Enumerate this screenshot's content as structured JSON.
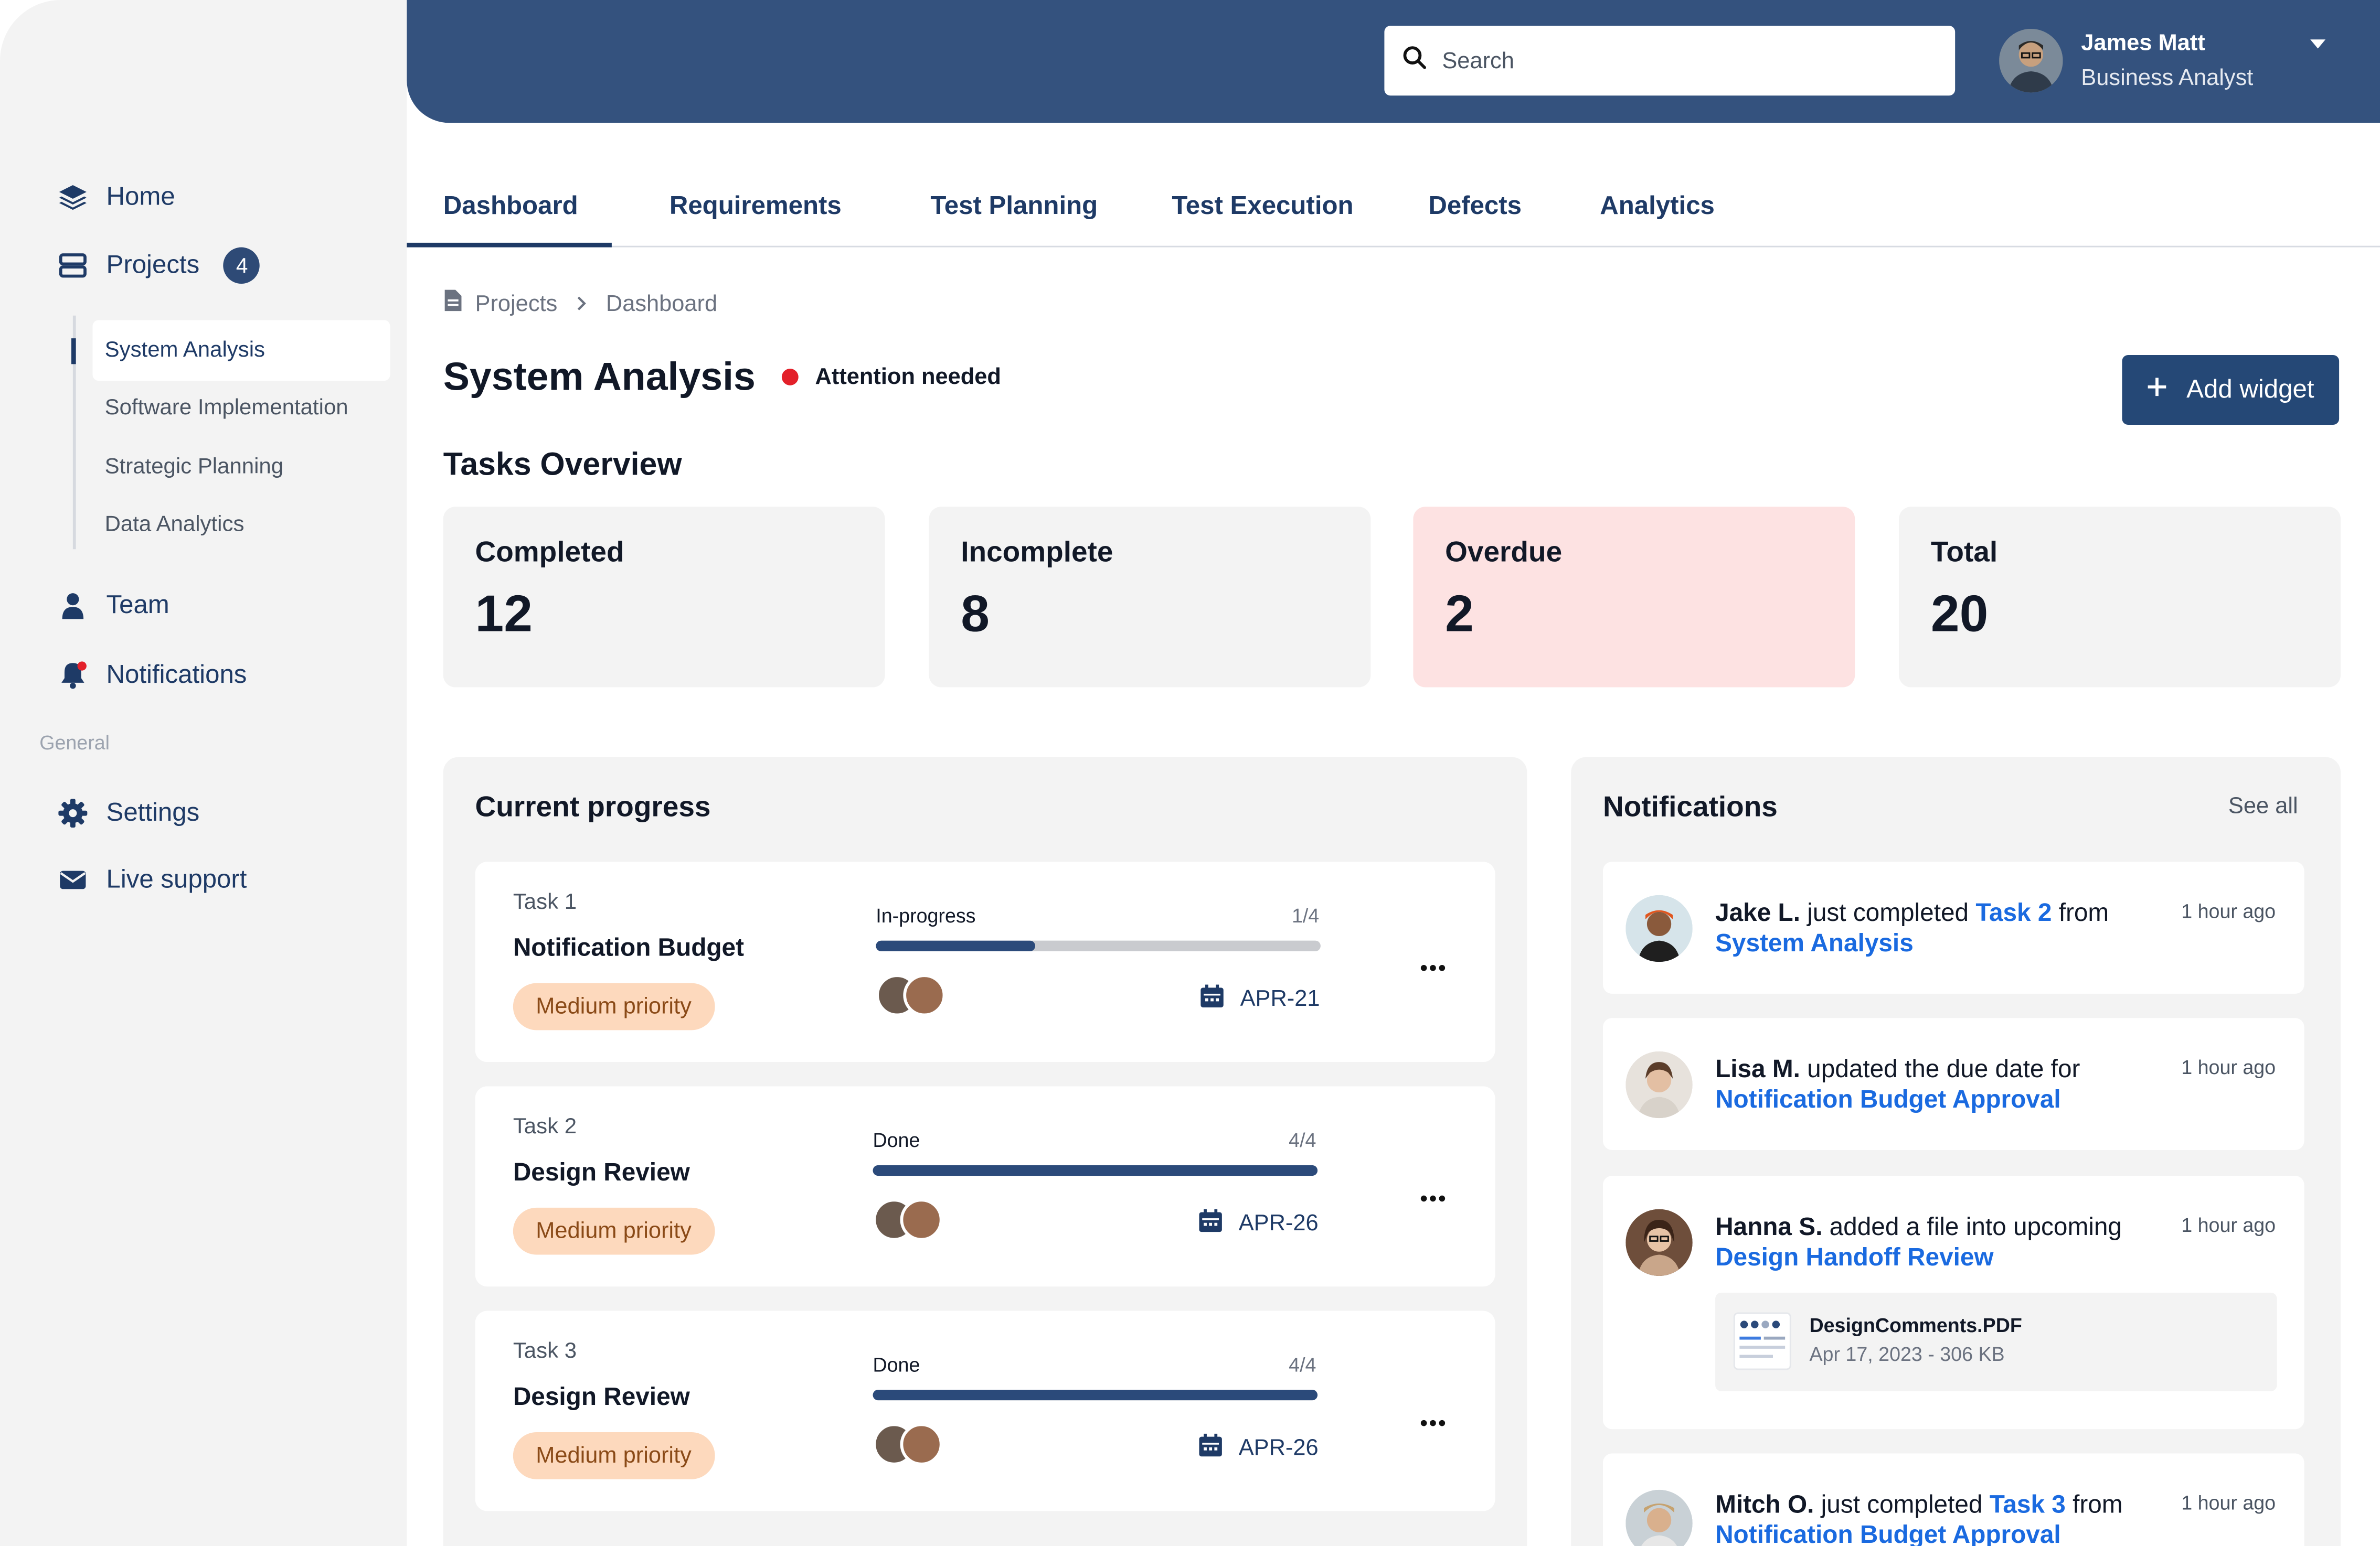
{
  "sidebar": {
    "items": [
      {
        "label": "Home",
        "icon": "layers-icon"
      },
      {
        "label": "Projects",
        "icon": "server-icon",
        "badge": "4"
      },
      {
        "label": "Team",
        "icon": "user-icon"
      },
      {
        "label": "Notifications",
        "icon": "bell-icon"
      },
      {
        "label": "Settings",
        "icon": "gear-icon"
      },
      {
        "label": "Live support",
        "icon": "envelope-icon"
      }
    ],
    "sub_items": [
      "System Analysis",
      "Software Implementation",
      "Strategic Planning",
      "Data Analytics"
    ],
    "section_general": "General"
  },
  "header": {
    "search_placeholder": "Search",
    "user_name": "James Matt",
    "user_role": "Business Analyst"
  },
  "tabs": [
    "Dashboard",
    "Requirements",
    "Test Planning",
    "Test Execution",
    "Defects",
    "Analytics"
  ],
  "breadcrumb": [
    "Projects",
    "Dashboard"
  ],
  "page": {
    "title": "System Analysis",
    "status": "Attention needed",
    "status_color": "#e3202a",
    "add_widget": "Add widget"
  },
  "tasks_overview": {
    "title": "Tasks Overview",
    "stats": [
      {
        "label": "Completed",
        "value": "12"
      },
      {
        "label": "Incomplete",
        "value": "8"
      },
      {
        "label": "Overdue",
        "value": "2"
      },
      {
        "label": "Total",
        "value": "20"
      }
    ]
  },
  "progress": {
    "title": "Current progress",
    "tasks": [
      {
        "label": "Task 1",
        "name": "Notification Budget",
        "priority": "Medium priority",
        "status": "In-progress",
        "count": "1/4",
        "fraction": 0.36,
        "date": "APR-21"
      },
      {
        "label": "Task 2",
        "name": "Design Review",
        "priority": "Medium priority",
        "status": "Done",
        "count": "4/4",
        "fraction": 1.0,
        "date": "APR-26"
      },
      {
        "label": "Task 3",
        "name": "Design Review",
        "priority": "Medium priority",
        "status": "Done",
        "count": "4/4",
        "fraction": 1.0,
        "date": "APR-26"
      }
    ]
  },
  "notifications": {
    "title": "Notifications",
    "see_all": "See all",
    "items": [
      {
        "name": "Jake L.",
        "pre": " just completed ",
        "link1": "Task 2",
        "mid": " from ",
        "link2": "System Analysis",
        "time": "1 hour ago"
      },
      {
        "name": "Lisa M.",
        "pre": " updated the due date for ",
        "link1": "Notification Budget Approval",
        "time": "1 hour ago"
      },
      {
        "name": "Hanna S.",
        "pre": " added a file into upcoming ",
        "link1": "Design Handoff Review",
        "time": "1 hour ago",
        "file": {
          "name": "DesignComments.PDF",
          "meta": "Apr 17, 2023 - 306 KB"
        }
      },
      {
        "name": "Mitch O.",
        "pre": " just completed ",
        "link1": "Task 3",
        "mid": " from ",
        "link2": "Notification Budget Approval",
        "time": "1 hour ago"
      }
    ]
  },
  "colors": {
    "primary": "#34527e",
    "accent_link": "#1a6ae0",
    "overdue_bg": "#fde2e2",
    "priority_bg": "#fdd9bd"
  }
}
